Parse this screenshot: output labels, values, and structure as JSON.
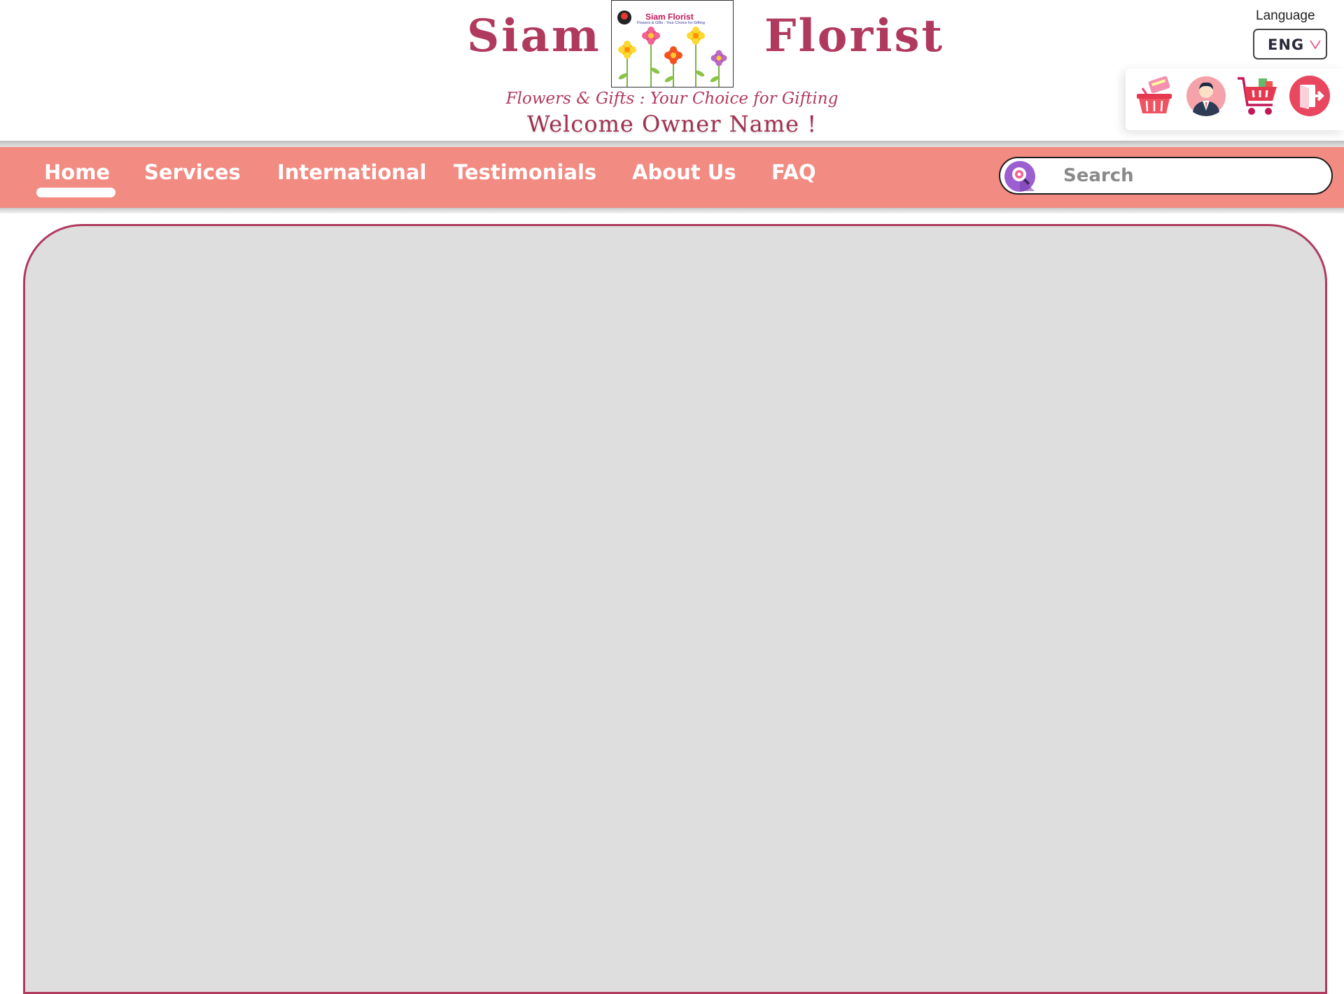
{
  "header": {
    "brand_left": "Siam",
    "brand_right": "Florist",
    "logo": {
      "title": "Siam Florist",
      "subtitle": "Flowers & Gifts : Your Choice for Gifting",
      "flower_colors": [
        "#f4c20d",
        "#e83e8c",
        "#f4c20d",
        "#ef5350",
        "#ab47bc"
      ]
    },
    "tagline": "Flowers & Gifts : Your Choice for Gifting",
    "welcome": "Welcome Owner Name !"
  },
  "language": {
    "label": "Language",
    "selected": "ENG"
  },
  "icons": {
    "basket": "basket-icon",
    "profile": "user-profile-icon",
    "cart": "shopping-cart-icon",
    "logout": "logout-icon"
  },
  "nav": {
    "items": [
      {
        "label": "Home",
        "active": true
      },
      {
        "label": "Services"
      },
      {
        "label": "International"
      },
      {
        "label": "Testimonials"
      },
      {
        "label": "About Us"
      },
      {
        "label": "FAQ"
      }
    ]
  },
  "search": {
    "placeholder": "Search"
  },
  "colors": {
    "brand": "#b03a5e",
    "nav_background": "#f28b82",
    "panel_background": "#dedede"
  }
}
